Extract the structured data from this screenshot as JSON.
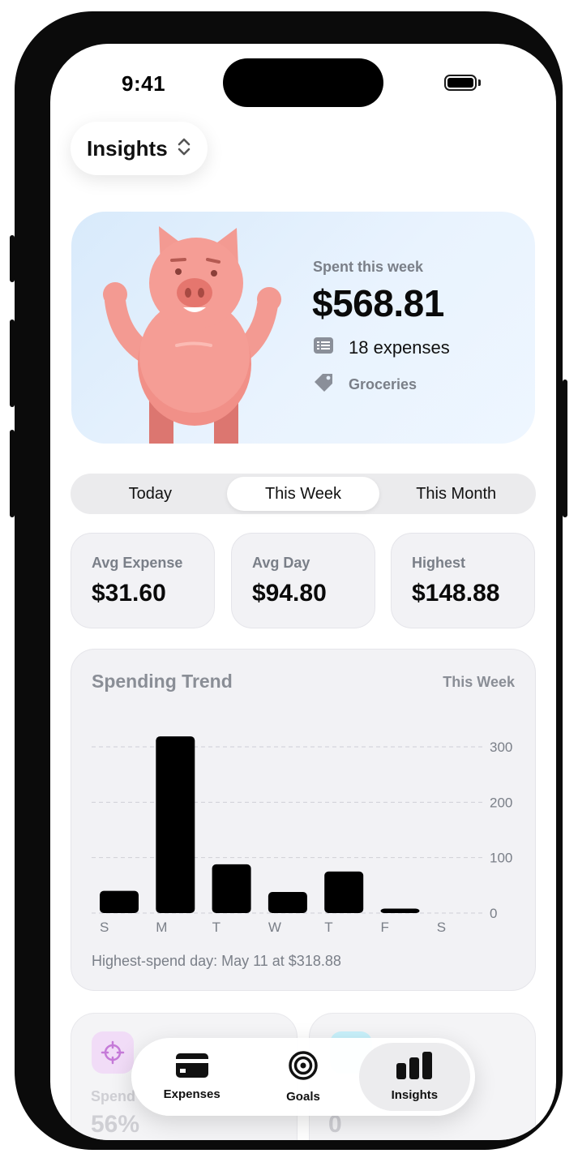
{
  "status_bar": {
    "time": "9:41"
  },
  "header": {
    "title": "Insights"
  },
  "hero": {
    "caption": "Spent this week",
    "amount": "$568.81",
    "expense_count_label": "18 expenses",
    "top_category": "Groceries"
  },
  "segments": [
    {
      "label": "Today",
      "active": false
    },
    {
      "label": "This Week",
      "active": true
    },
    {
      "label": "This Month",
      "active": false
    }
  ],
  "stats": [
    {
      "label": "Avg Expense",
      "value": "$31.60"
    },
    {
      "label": "Avg Day",
      "value": "$94.80"
    },
    {
      "label": "Highest",
      "value": "$148.88"
    }
  ],
  "trend": {
    "title": "Spending Trend",
    "period": "This Week",
    "footer": "Highest-spend day: May 11 at $318.88"
  },
  "chart_data": {
    "type": "bar",
    "categories": [
      "S",
      "M",
      "T",
      "W",
      "T",
      "F",
      "S"
    ],
    "values": [
      40,
      318.88,
      88,
      38,
      75,
      8,
      0
    ],
    "ylim": [
      0,
      320
    ],
    "yticks": [
      0,
      100,
      200,
      300
    ],
    "y_axis_side": "right",
    "grid": true,
    "bar_color": "#000000"
  },
  "peek_cards": [
    {
      "label": "Spend",
      "value": "56%"
    },
    {
      "label": "",
      "value": "0"
    }
  ],
  "tabbar": {
    "items": [
      {
        "label": "Expenses",
        "icon": "card-icon",
        "active": false
      },
      {
        "label": "Goals",
        "icon": "target-icon",
        "active": false
      },
      {
        "label": "Insights",
        "icon": "chart-icon",
        "active": true
      }
    ]
  },
  "colors": {
    "hero_bg": "#e3effc",
    "card_bg": "#f2f2f5",
    "pig": "#f4918a",
    "accent_purple": "#c57ad8"
  }
}
